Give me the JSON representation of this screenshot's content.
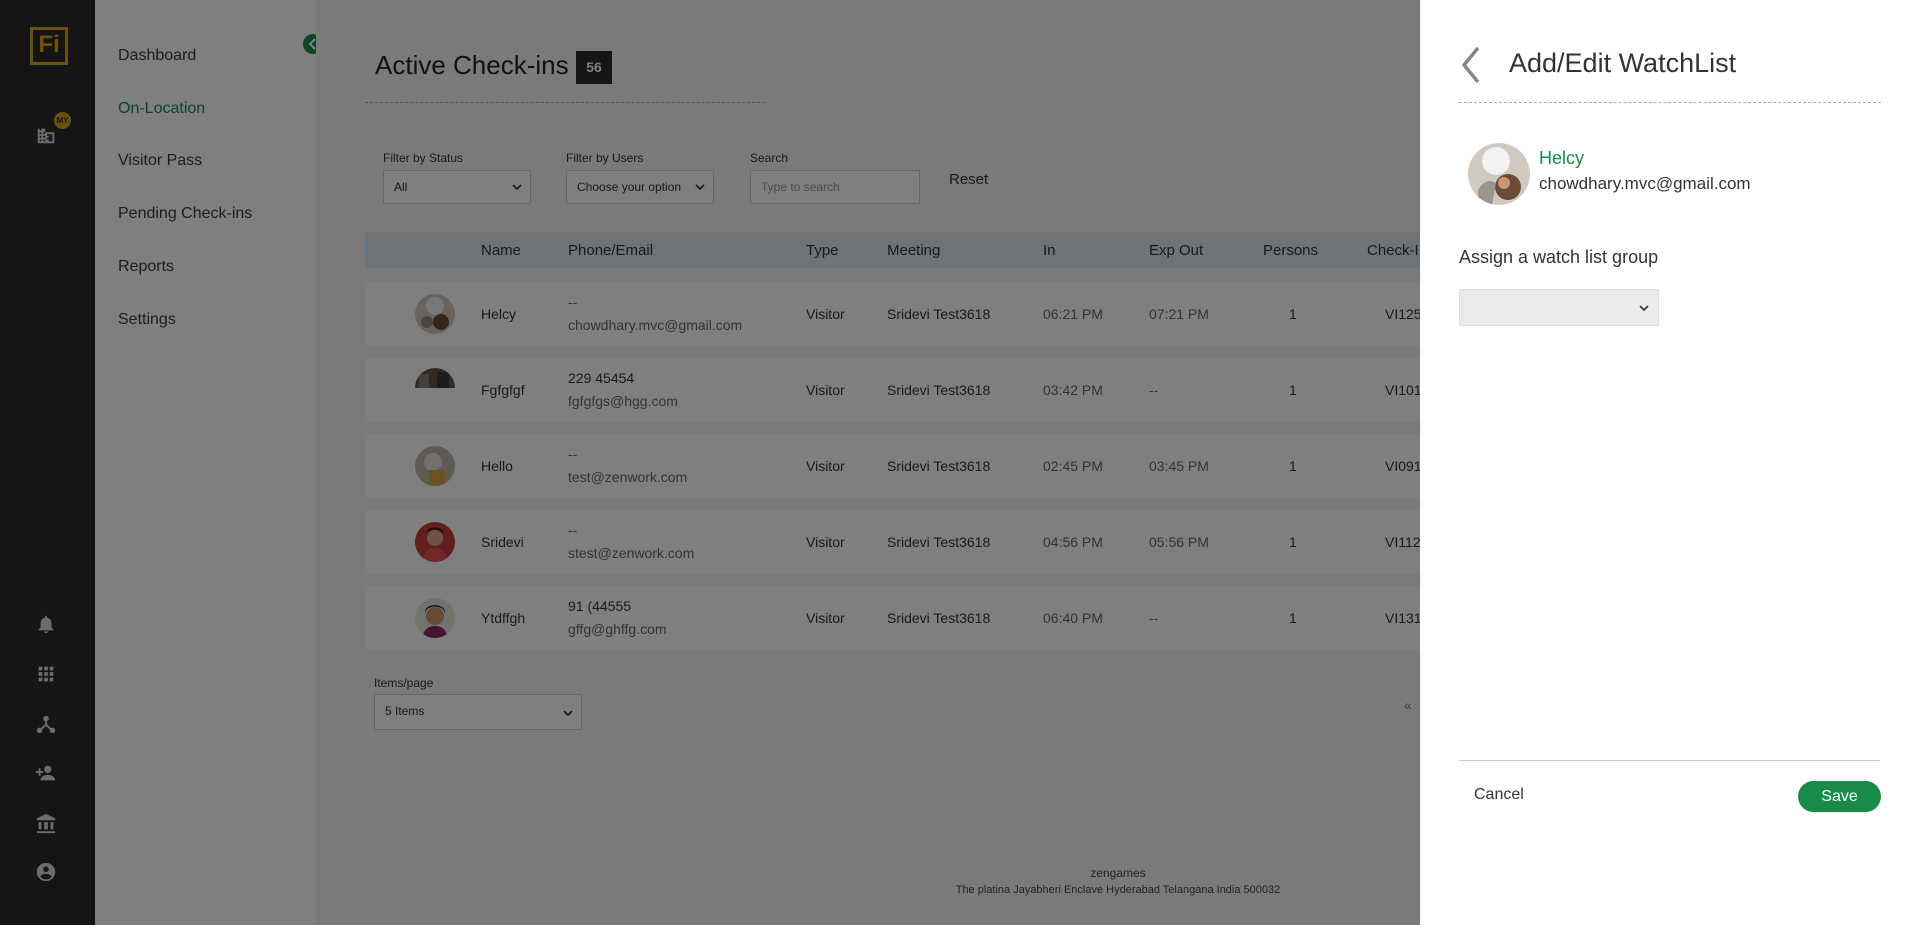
{
  "app": {
    "logo_text": "Fi",
    "badge_text": "MY"
  },
  "sidenav": {
    "items": [
      {
        "label": "Dashboard",
        "active": false
      },
      {
        "label": "On-Location",
        "active": true
      },
      {
        "label": "Visitor Pass",
        "active": false
      },
      {
        "label": "Pending Check-ins",
        "active": false
      },
      {
        "label": "Reports",
        "active": false
      },
      {
        "label": "Settings",
        "active": false
      }
    ]
  },
  "main": {
    "title": "Active Check-ins",
    "count": "56",
    "filters": {
      "status_label": "Filter by Status",
      "status_value": "All",
      "users_label": "Filter by Users",
      "users_value": "Choose your option",
      "search_label": "Search",
      "search_placeholder": "Type to search",
      "reset_label": "Reset"
    },
    "table": {
      "headers": [
        "Name",
        "Phone/Email",
        "Type",
        "Meeting",
        "In",
        "Exp Out",
        "Persons",
        "Check-I"
      ],
      "rows": [
        {
          "name": "Helcy",
          "phone": "--",
          "email": "chowdhary.mvc@gmail.com",
          "type": "Visitor",
          "meeting": "Sridevi Test3618",
          "in": "06:21 PM",
          "exp_out": "07:21 PM",
          "persons": "1",
          "checkin": "VI125"
        },
        {
          "name": "Fgfgfgf",
          "phone": "229 45454",
          "email": "fgfgfgs@hgg.com",
          "type": "Visitor",
          "meeting": "Sridevi Test3618",
          "in": "03:42 PM",
          "exp_out": "--",
          "persons": "1",
          "checkin": "VI101"
        },
        {
          "name": "Hello",
          "phone": "--",
          "email": "test@zenwork.com",
          "type": "Visitor",
          "meeting": "Sridevi Test3618",
          "in": "02:45 PM",
          "exp_out": "03:45 PM",
          "persons": "1",
          "checkin": "VI091"
        },
        {
          "name": "Sridevi",
          "phone": "--",
          "email": "stest@zenwork.com",
          "type": "Visitor",
          "meeting": "Sridevi Test3618",
          "in": "04:56 PM",
          "exp_out": "05:56 PM",
          "persons": "1",
          "checkin": "VI112"
        },
        {
          "name": "Ytdffgh",
          "phone": "91 (44555",
          "email": "gffg@ghffg.com",
          "type": "Visitor",
          "meeting": "Sridevi Test3618",
          "in": "06:40 PM",
          "exp_out": "--",
          "persons": "1",
          "checkin": "VI131"
        }
      ]
    },
    "pagination": {
      "items_label": "Items/page",
      "items_value": "5 Items",
      "prev": "«"
    },
    "footer": {
      "company": "zengames",
      "address": "The platina Jayabheri Enclave Hyderabad Telangana India 500032"
    }
  },
  "panel": {
    "title": "Add/Edit WatchList",
    "person_name": "Helcy",
    "person_email": "chowdhary.mvc@gmail.com",
    "assign_label": "Assign a watch list group",
    "assign_value": "",
    "cancel_label": "Cancel",
    "save_label": "Save"
  },
  "colors": {
    "accent": "#1a8a4a",
    "rail": "#2b2b2b",
    "logo": "#d8a31a"
  }
}
